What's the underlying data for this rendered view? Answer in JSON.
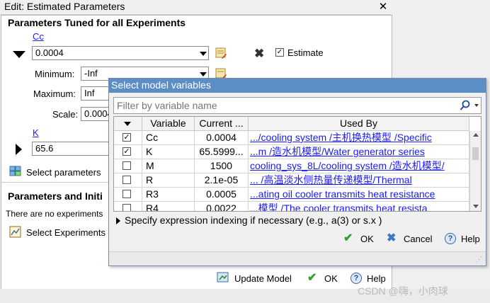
{
  "outer": {
    "title": "Edit: Estimated Parameters",
    "section1_title": "Parameters Tuned for all Experiments",
    "param_cc": {
      "name": "Cc",
      "value": "0.0004",
      "minimum_label": "Minimum:",
      "minimum": "-Inf",
      "maximum_label": "Maximum:",
      "maximum": "Inf",
      "scale_label": "Scale:",
      "scale": "0.0004",
      "estimate_label": "Estimate"
    },
    "param_k": {
      "name": "K",
      "value": "65.6"
    },
    "select_parameters_label": "Select parameters",
    "section2_title": "Parameters and Initi",
    "no_experiments_text": "There are no experiments",
    "select_experiments_label": "Select Experiments",
    "update_model_label": "Update Model",
    "ok_label": "OK",
    "help_label": "Help"
  },
  "popup": {
    "title": "Select model variables",
    "filter_placeholder": "Filter by variable name",
    "columns": [
      "Variable",
      "Current ...",
      "Used By"
    ],
    "rows": [
      {
        "checked": true,
        "variable": "Cc",
        "current": "0.0004",
        "used_by": ".../cooling system /主机换热模型 /Specific"
      },
      {
        "checked": true,
        "variable": "K",
        "current": "65.5999...",
        "used_by": "...m /造水机模型/Water generator series"
      },
      {
        "checked": false,
        "variable": "M",
        "current": "1500",
        "used_by": "cooling_sys_8L/cooling system /造水机模型/"
      },
      {
        "checked": false,
        "variable": "R",
        "current": "2.1e-05",
        "used_by": "... /高温淡水侧热量传递模型/Thermal"
      },
      {
        "checked": false,
        "variable": "R3",
        "current": "0.0005",
        "used_by": "...ating oil cooler transmits heat resistance"
      },
      {
        "checked": false,
        "variable": "R4",
        "current": "0.0022",
        "used_by": "...模型 /The cooler transmits heat resista"
      }
    ],
    "expression_label": "Specify expression indexing if necessary (e.g., a(3) or s.x )",
    "ok_label": "OK",
    "cancel_label": "Cancel",
    "help_label": "Help"
  },
  "watermark": "CSDN @嗨，小肉球",
  "colors": {
    "popup_title_bg": "#5b8ec7",
    "link": "#1a1aff"
  }
}
